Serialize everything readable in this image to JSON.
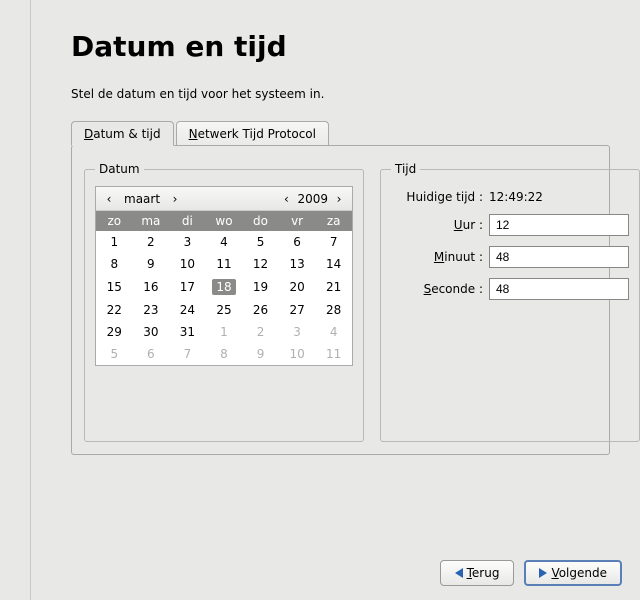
{
  "title": "Datum en tijd",
  "subtitle": "Stel de datum en tijd voor het systeem in.",
  "tabs": {
    "datetime": {
      "prefix": "D",
      "rest": "atum & tijd"
    },
    "ntp": {
      "prefix": "N",
      "rest": "etwerk Tijd Protocol"
    }
  },
  "date_group": {
    "legend": "Datum",
    "month": "maart",
    "year": "2009",
    "nav_prev_month": "‹",
    "nav_next_month": "›",
    "nav_prev_year": "‹",
    "nav_next_year": "›",
    "weekdays": [
      "zo",
      "ma",
      "di",
      "wo",
      "do",
      "vr",
      "za"
    ],
    "rows": [
      [
        {
          "d": "1"
        },
        {
          "d": "2"
        },
        {
          "d": "3"
        },
        {
          "d": "4"
        },
        {
          "d": "5"
        },
        {
          "d": "6"
        },
        {
          "d": "7"
        }
      ],
      [
        {
          "d": "8"
        },
        {
          "d": "9"
        },
        {
          "d": "10"
        },
        {
          "d": "11"
        },
        {
          "d": "12"
        },
        {
          "d": "13"
        },
        {
          "d": "14"
        }
      ],
      [
        {
          "d": "15"
        },
        {
          "d": "16"
        },
        {
          "d": "17"
        },
        {
          "d": "18",
          "sel": true
        },
        {
          "d": "19"
        },
        {
          "d": "20"
        },
        {
          "d": "21"
        }
      ],
      [
        {
          "d": "22"
        },
        {
          "d": "23"
        },
        {
          "d": "24"
        },
        {
          "d": "25"
        },
        {
          "d": "26"
        },
        {
          "d": "27"
        },
        {
          "d": "28"
        }
      ],
      [
        {
          "d": "29"
        },
        {
          "d": "30"
        },
        {
          "d": "31"
        },
        {
          "d": "1",
          "o": true
        },
        {
          "d": "2",
          "o": true
        },
        {
          "d": "3",
          "o": true
        },
        {
          "d": "4",
          "o": true
        }
      ],
      [
        {
          "d": "5",
          "o": true
        },
        {
          "d": "6",
          "o": true
        },
        {
          "d": "7",
          "o": true
        },
        {
          "d": "8",
          "o": true
        },
        {
          "d": "9",
          "o": true
        },
        {
          "d": "10",
          "o": true
        },
        {
          "d": "11",
          "o": true
        }
      ]
    ]
  },
  "time_group": {
    "legend": "Tijd",
    "current_label": "Huidige tijd :",
    "current_value": "12:49:22",
    "hour": {
      "prefix": "U",
      "rest": "ur :",
      "value": "12"
    },
    "minute": {
      "prefix": "M",
      "rest": "inuut :",
      "value": "48"
    },
    "second": {
      "prefix": "S",
      "rest": "econde :",
      "value": "48"
    }
  },
  "footer": {
    "back": {
      "prefix": "T",
      "rest": "erug"
    },
    "forward": {
      "prefix": "V",
      "rest": "olgende"
    }
  }
}
